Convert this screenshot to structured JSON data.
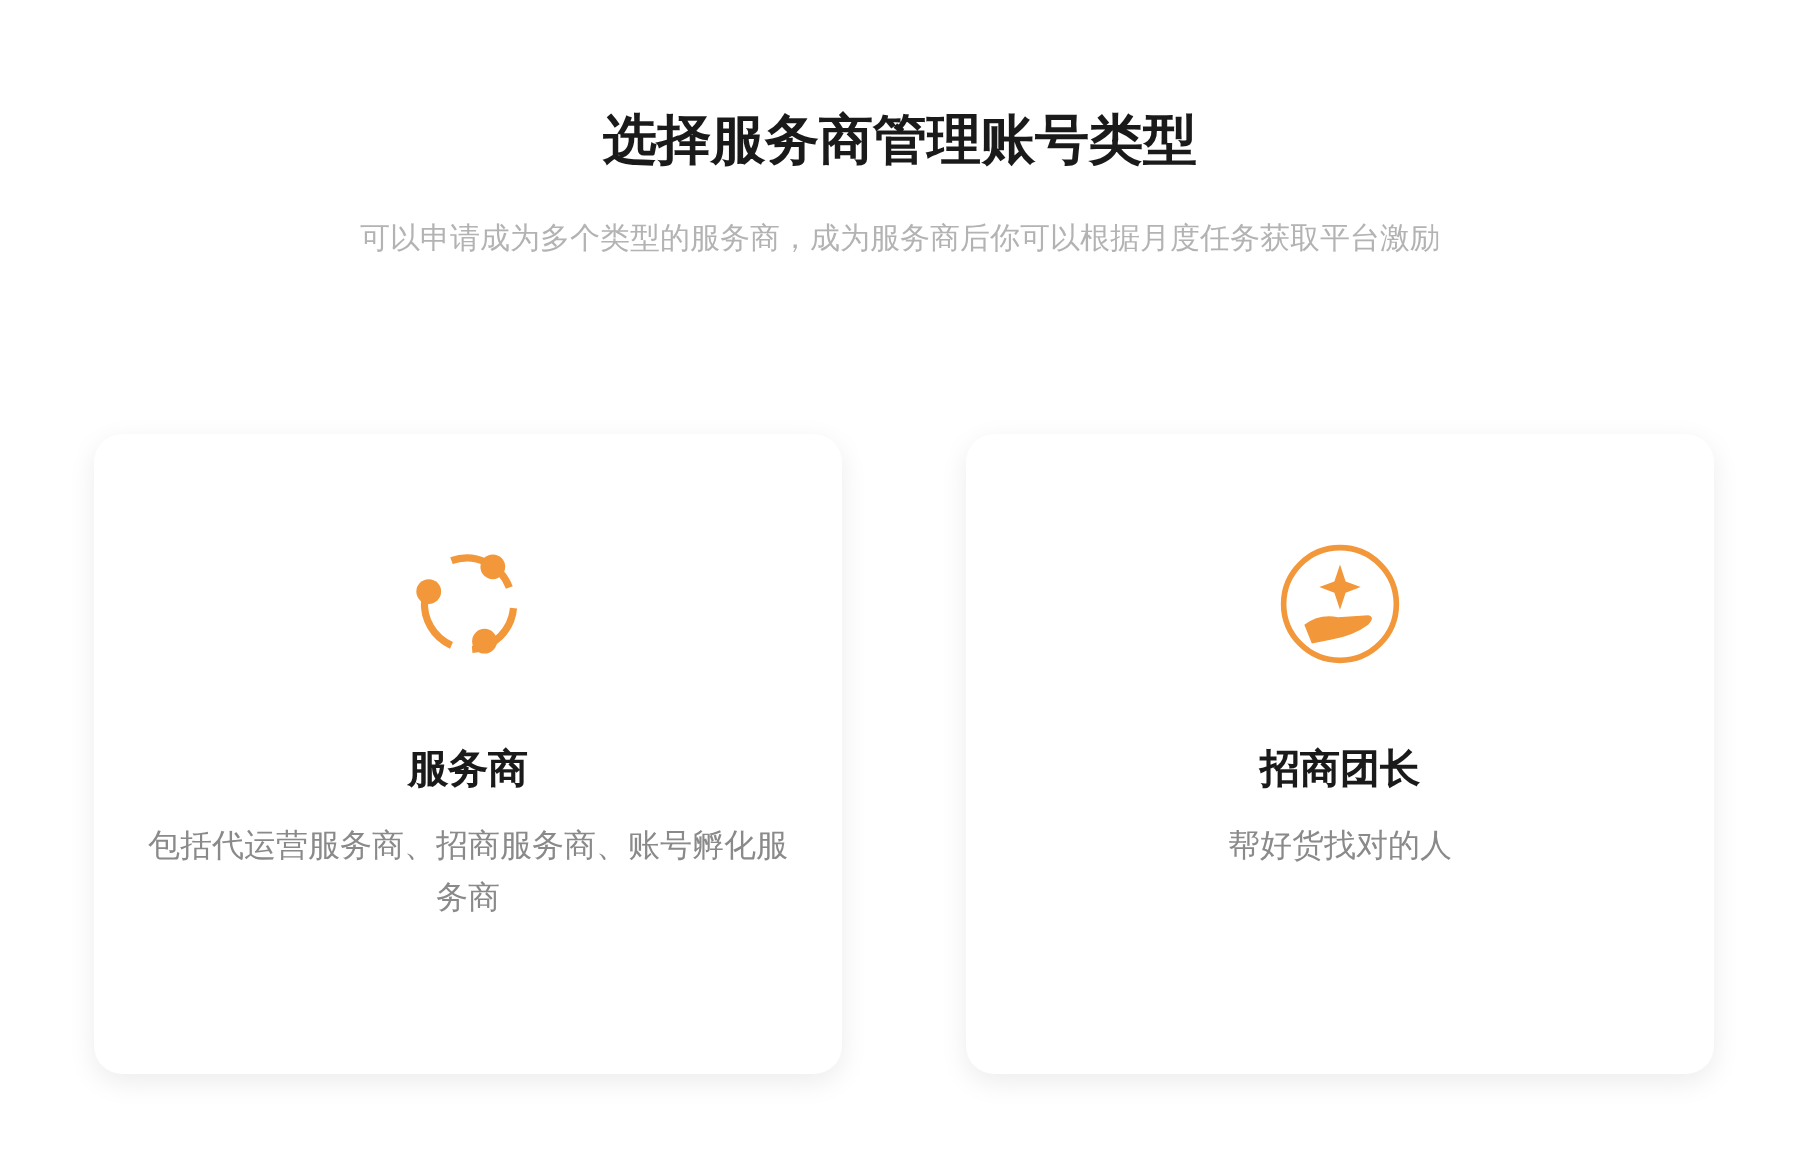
{
  "title": "选择服务商管理账号类型",
  "subtitle": "可以申请成为多个类型的服务商，成为服务商后你可以根据月度任务获取平台激励",
  "cards": [
    {
      "kind": "service",
      "name": "服务商",
      "description": "包括代运营服务商、招商服务商、账号孵化服务商"
    },
    {
      "kind": "leader",
      "name": "招商团长",
      "description": "帮好货找对的人"
    }
  ]
}
